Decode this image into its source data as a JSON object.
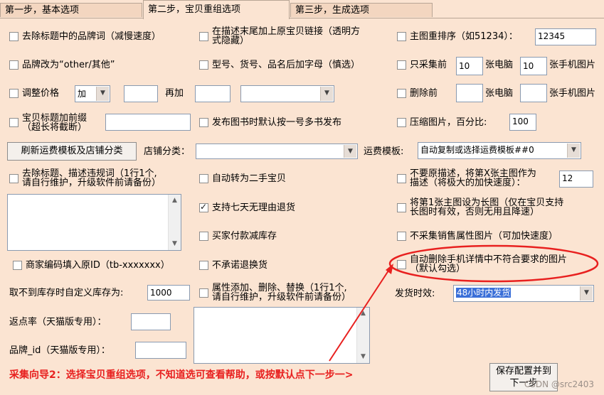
{
  "tabs": [
    "第一步，基本选项",
    "第二步，宝贝重组选项",
    "第三步，生成选项"
  ],
  "left": {
    "remove_brand": "去除标题中的品牌词（减慢速度）",
    "brand_to_other": "品牌改为“other/其他”",
    "adjust_price": "调整价格",
    "price_op": "加",
    "price_value": "",
    "add_again": "再加",
    "add_value": "",
    "price_mode": "",
    "title_prefix_line1": "宝贝标题加前缀",
    "title_prefix_line2": "（超长将截断）",
    "title_prefix_value": "",
    "refresh_button": "刷新运费模板及店铺分类",
    "store_category_label": "店铺分类：",
    "store_category_value": "",
    "remove_illegal_line1": "去除标题、描述违规词（1行1个,",
    "remove_illegal_line2": "请自行维护，升级软件前请备份）",
    "merchant_code": "商家编码填入原ID（tb-xxxxxxx）",
    "stock_label": "取不到库存时自定义库存为:",
    "stock_value": "1000",
    "rebate_label": "返点率（天猫版专用）：",
    "rebate_value": "",
    "brand_id_label": "品牌_id（天猫版专用）：",
    "brand_id_value": ""
  },
  "middle": {
    "append_link_line1": "在描述末尾加上原宝贝链接（透明方",
    "append_link_line2": "式隐藏）",
    "model_suffix": "型号、货号、品名后加字母（慎选）",
    "publish_book": "发布图书时默认按一号多书发布",
    "auto_second_hand": "自动转为二手宝贝",
    "seven_day_return": "支持七天无理由退货",
    "buyer_pay_stock": "买家付款减库存",
    "no_exchange": "不承诺退换货",
    "attr_line1": "属性添加、删除、替换（1行1个,",
    "attr_line2": "请自行维护，升级软件前请备份）"
  },
  "right": {
    "reorder_main": "主图重排序（如51234）：",
    "reorder_value": "12345",
    "collect_first": "只采集前",
    "pc_value": "10",
    "pc_label": "张电脑",
    "mobile_value": "10",
    "mobile_label": "张手机图片",
    "delete_first": "删除前",
    "del_pc_value": "",
    "del_pc_label": "张电脑",
    "del_mobile_value": "",
    "del_mobile_label": "张手机图片",
    "compress": "压缩图片，百分比:",
    "compress_value": "100",
    "shipping_label": "运费模板:",
    "shipping_value": "自动复制或选择运费模板##0",
    "no_orig_desc_line1": "不要原描述，将第X张主图作为",
    "no_orig_desc_line2": "描述（将极大的加快速度）：",
    "no_orig_value": "12",
    "long_img_line1": "将第1张主图设为长图（仅在宝贝支持",
    "long_img_line2": "长图时有效，否则无用且降速）",
    "no_sale_attr": "不采集销售属性图片（可加快速度）",
    "auto_delete_line1": "自动删除手机详情中不符合要求的图片",
    "auto_delete_line2": "（默认勾选）",
    "delivery_label": "发货时效:",
    "delivery_value": "48小时内发货"
  },
  "footer": {
    "guide": "采集向导2：选择宝贝重组选项，不知道选可查看帮助，或按默认点下一步一>",
    "save_line1": "保存配置并到",
    "save_line2": "下一步",
    "watermark": "CSDN @src2403"
  },
  "colors": {
    "background": "#fbe4d2",
    "guide_text": "#e8201f",
    "selection": "#3a6fd8"
  }
}
